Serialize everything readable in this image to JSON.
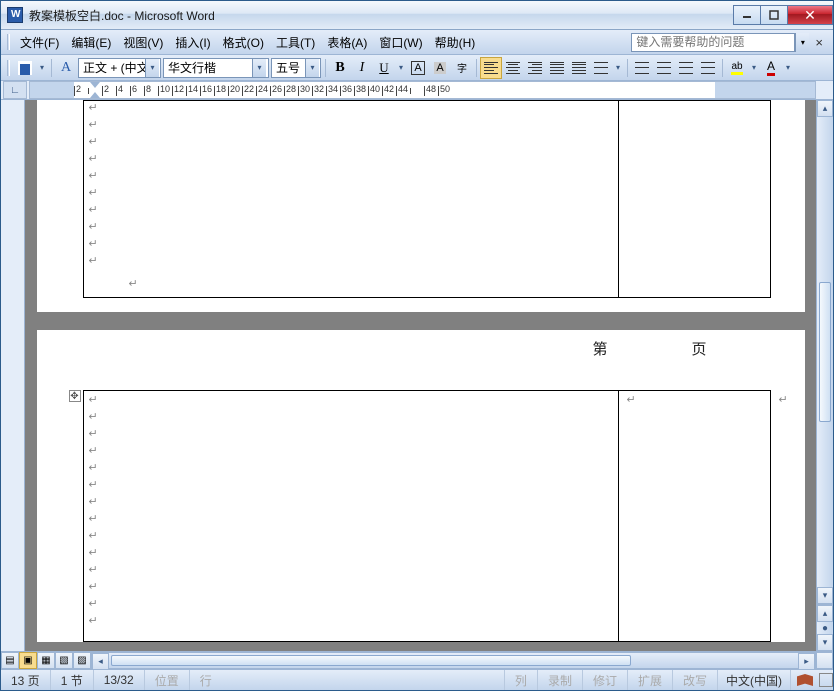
{
  "title": "教案模板空白.doc - Microsoft Word",
  "menu": {
    "file": "文件(F)",
    "edit": "编辑(E)",
    "view": "视图(V)",
    "insert": "插入(I)",
    "format": "格式(O)",
    "tools": "工具(T)",
    "table": "表格(A)",
    "window": "窗口(W)",
    "help": "帮助(H)"
  },
  "help_placeholder": "键入需要帮助的问题",
  "toolbar": {
    "style": "正文 + (中文",
    "font": "华文行楷",
    "size": "五号",
    "bold": "B",
    "italic": "I",
    "underline": "U",
    "a_border": "A",
    "a_char": "A",
    "a_hl": "A"
  },
  "ruler": {
    "numbers": [
      "2",
      "",
      "2",
      "4",
      "6",
      "8",
      "10",
      "12",
      "14",
      "16",
      "18",
      "20",
      "22",
      "24",
      "26",
      "28",
      "30",
      "32",
      "34",
      "36",
      "38",
      "40",
      "42",
      "44",
      "",
      "48",
      "50"
    ]
  },
  "page_header": "第　　页",
  "status": {
    "page": "13 页",
    "sec": "1 节",
    "pages": "13/32",
    "pos": "位置",
    "line": "行",
    "col": "列",
    "rec": "录制",
    "rev": "修订",
    "ext": "扩展",
    "ovr": "改写",
    "lang": "中文(中国)"
  }
}
